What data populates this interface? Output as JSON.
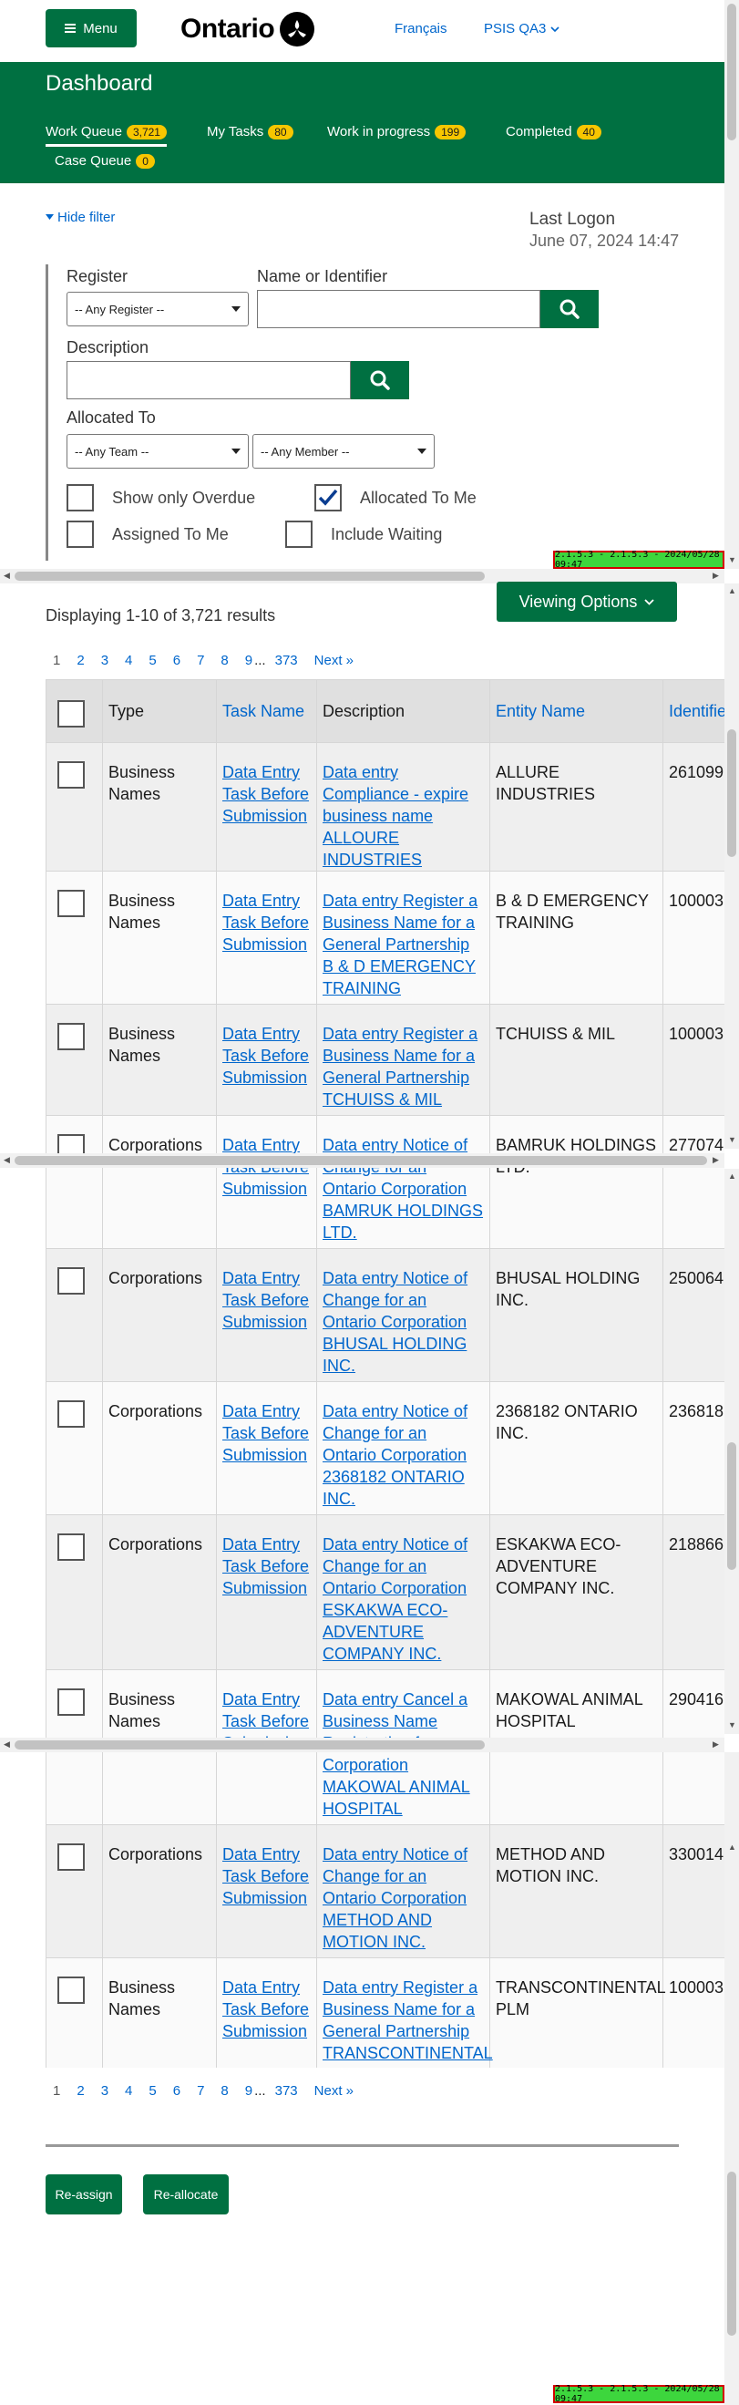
{
  "header": {
    "menu_label": "Menu",
    "logo_text": "Ontario",
    "language_link": "Français",
    "env_label": "PSIS QA3"
  },
  "dashboard": {
    "title": "Dashboard",
    "tabs": [
      {
        "label": "Work Queue",
        "count": "3,721",
        "active": true
      },
      {
        "label": "My Tasks",
        "count": "80"
      },
      {
        "label": "Work in progress",
        "count": "199"
      },
      {
        "label": "Completed",
        "count": "40"
      },
      {
        "label": "Case Queue",
        "count": "0"
      }
    ]
  },
  "filter": {
    "hide_label": "Hide filter",
    "last_logon_label": "Last Logon",
    "last_logon_value": "June 07, 2024 14:47",
    "register_label": "Register",
    "register_value": "-- Any Register --",
    "name_label": "Name or Identifier",
    "description_label": "Description",
    "allocated_label": "Allocated To",
    "team_value": "-- Any Team --",
    "member_value": "-- Any Member --",
    "checkboxes": [
      {
        "label": "Show only Overdue",
        "checked": false
      },
      {
        "label": "Allocated To Me",
        "checked": true
      },
      {
        "label": "Assigned To Me",
        "checked": false
      },
      {
        "label": "Include Waiting",
        "checked": false
      }
    ]
  },
  "version_tag": "2.1.5.3 - 2.1.5.3 - 2024/05/28 09:47",
  "results": {
    "displaying": "Displaying 1-10 of 3,721 results",
    "viewing_options": "Viewing Options",
    "pages": [
      "1",
      "2",
      "3",
      "4",
      "5",
      "6",
      "7",
      "8",
      "9",
      "...",
      "373",
      "Next »"
    ],
    "columns": [
      "Type",
      "Task Name",
      "Description",
      "Entity Name",
      "Identifier"
    ],
    "rows": [
      {
        "type": "Business Names",
        "task": "Data Entry Task Before Submission",
        "desc": "Data entry Compliance - expire business name ALLOURE INDUSTRIES",
        "entity": "ALLURE INDUSTRIES",
        "id": "261099"
      },
      {
        "type": "Business Names",
        "task": "Data Entry Task Before Submission",
        "desc": "Data entry Register a Business Name for a General Partnership B & D EMERGENCY TRAINING",
        "entity": "B & D EMERGENCY TRAINING",
        "id": "100003"
      },
      {
        "type": "Business Names",
        "task": "Data Entry Task Before Submission",
        "desc": "Data entry Register a Business Name for a General Partnership TCHUISS & MIL",
        "entity": "TCHUISS & MIL",
        "id": "100003"
      },
      {
        "type": "Corporations",
        "task": "Data Entry Task Before Submission",
        "desc": "Data entry Notice of Change for an Ontario Corporation BAMRUK HOLDINGS LTD.",
        "entity": "BAMRUK HOLDINGS LTD.",
        "id": "277074"
      },
      {
        "type": "Corporations",
        "task": "Data Entry Task Before Submission",
        "desc": "Data entry Notice of Change for an Ontario Corporation BHUSAL HOLDING INC.",
        "entity": "BHUSAL HOLDING INC.",
        "id": "250064"
      },
      {
        "type": "Corporations",
        "task": "Data Entry Task Before Submission",
        "desc": "Data entry Notice of Change for an Ontario Corporation 2368182 ONTARIO INC.",
        "entity": "2368182 ONTARIO INC.",
        "id": "236818"
      },
      {
        "type": "Corporations",
        "task": "Data Entry Task Before Submission",
        "desc": "Data entry Notice of Change for an Ontario Corporation ESKAKWA ECO-ADVENTURE COMPANY INC.",
        "entity": "ESKAKWA ECO-ADVENTURE COMPANY INC.",
        "id": "218866"
      },
      {
        "type": "Business Names",
        "task": "Data Entry Task Before Submission",
        "desc": "Data entry Cancel a Business Name Registration for a Corporation MAKOWAL ANIMAL HOSPITAL",
        "entity": "MAKOWAL ANIMAL HOSPITAL",
        "id": "290416"
      },
      {
        "type": "Corporations",
        "task": "Data Entry Task Before Submission",
        "desc": "Data entry Notice of Change for an Ontario Corporation METHOD AND MOTION INC.",
        "entity": "METHOD AND MOTION INC.",
        "id": "330014"
      },
      {
        "type": "Business Names",
        "task": "Data Entry Task Before Submission",
        "desc": "Data entry Register a Business Name for a General Partnership TRANSCONTINENTAL PLM",
        "entity": "TRANSCONTINENTAL PLM",
        "id": "100003"
      }
    ]
  },
  "actions": {
    "reassign": "Re-assign",
    "reallocate": "Re-allocate"
  },
  "colors": {
    "brand_green": "#007041",
    "badge_yellow": "#f7c600",
    "link_blue": "#0066cc"
  }
}
